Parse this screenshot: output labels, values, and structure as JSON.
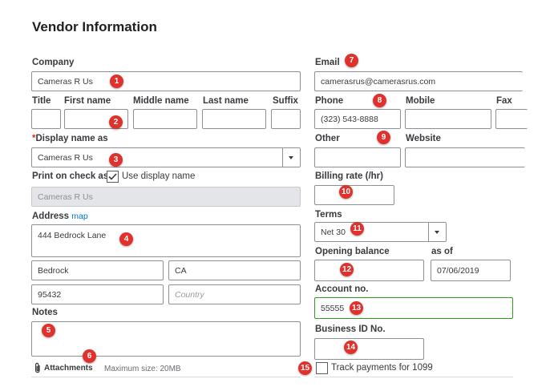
{
  "page": {
    "title": "Vendor Information"
  },
  "company": {
    "label": "Company",
    "value": "Cameras R Us"
  },
  "name": {
    "title_label": "Title",
    "first_label": "First name",
    "middle_label": "Middle name",
    "last_label": "Last name",
    "suffix_label": "Suffix"
  },
  "display_name": {
    "required_mark": "*",
    "label": "Display name as",
    "value": "Cameras R Us"
  },
  "print_check": {
    "label": "Print on check as",
    "checkbox_label": "Use display name",
    "checked": true,
    "value": "Cameras R Us"
  },
  "address": {
    "label": "Address",
    "map_link": "map",
    "street": "444 Bedrock Lane",
    "city": "Bedrock",
    "state": "CA",
    "zip": "95432",
    "country_placeholder": "Country"
  },
  "notes": {
    "label": "Notes"
  },
  "attachments": {
    "label": "Attachments",
    "max_size": "Maximum size: 20MB"
  },
  "email": {
    "label": "Email",
    "value": "camerasrus@camerasrus.com"
  },
  "phone": {
    "label": "Phone",
    "value": "(323) 543-8888",
    "mobile_label": "Mobile",
    "fax_label": "Fax"
  },
  "other": {
    "label": "Other",
    "website_label": "Website"
  },
  "billing_rate": {
    "label": "Billing rate (/hr)"
  },
  "terms": {
    "label": "Terms",
    "value": "Net 30"
  },
  "opening_balance": {
    "label": "Opening balance",
    "as_of_label": "as of",
    "date": "07/06/2019"
  },
  "account_no": {
    "label": "Account no.",
    "value": "55555"
  },
  "business_id": {
    "label": "Business ID No."
  },
  "track_1099": {
    "label": "Track payments for 1099",
    "checked": false
  },
  "badges": [
    "1",
    "2",
    "3",
    "4",
    "5",
    "6",
    "7",
    "8",
    "9",
    "10",
    "11",
    "12",
    "13",
    "14",
    "15"
  ],
  "colors": {
    "badge": "#e0312c",
    "focus_border": "#2ca01c",
    "link": "#0077c5",
    "required": "#d52b1e"
  }
}
